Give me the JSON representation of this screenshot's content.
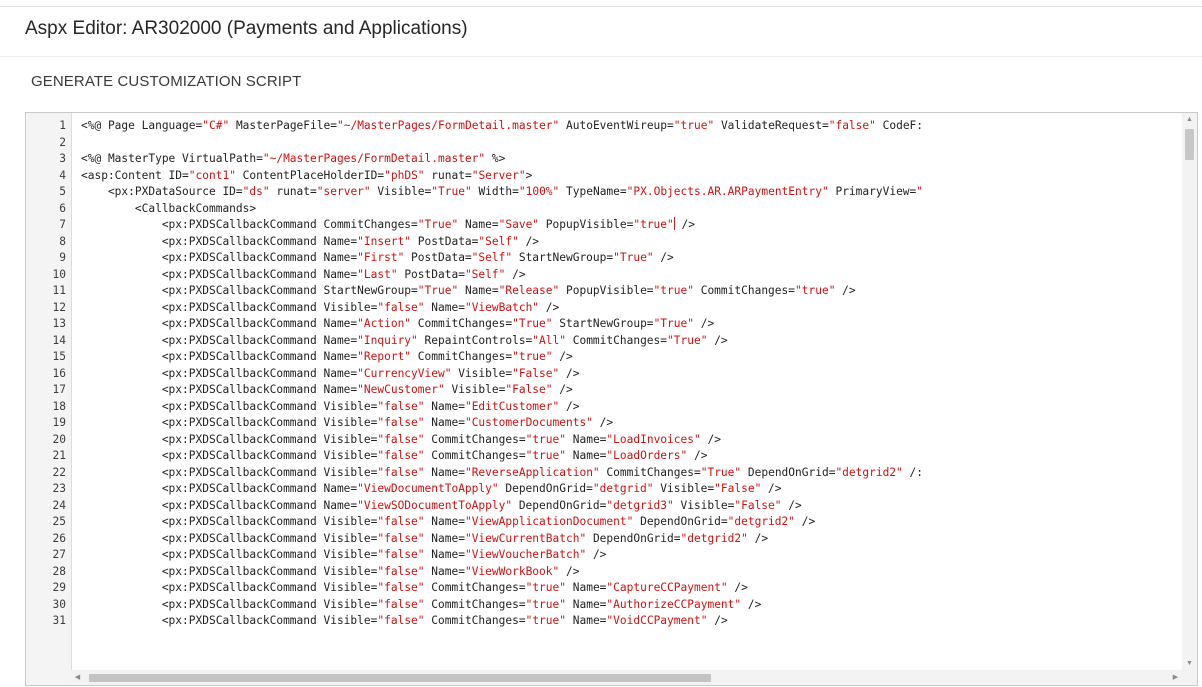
{
  "header": {
    "title": "Aspx Editor: AR302000 (Payments and Applications)",
    "generate_button": "GENERATE CUSTOMIZATION SCRIPT"
  },
  "editor": {
    "line_numbers": [
      "1",
      "2",
      "3",
      "4",
      "5",
      "6",
      "7",
      "8",
      "9",
      "10",
      "11",
      "12",
      "13",
      "14",
      "15",
      "16",
      "17",
      "18",
      "19",
      "20",
      "21",
      "22",
      "23",
      "24",
      "25",
      "26",
      "27",
      "28",
      "29",
      "30",
      "31"
    ],
    "lines": [
      [
        [
          "t",
          "<%@ Page Language="
        ],
        [
          "s",
          "\"C#\""
        ],
        [
          "t",
          " MasterPageFile="
        ],
        [
          "s",
          "\"~/MasterPages/FormDetail.master\""
        ],
        [
          "t",
          " AutoEventWireup="
        ],
        [
          "s",
          "\"true\""
        ],
        [
          "t",
          " ValidateRequest="
        ],
        [
          "s",
          "\"false\""
        ],
        [
          "t",
          " CodeF:"
        ]
      ],
      [],
      [
        [
          "t",
          "<%@ MasterType VirtualPath="
        ],
        [
          "s",
          "\"~/MasterPages/FormDetail.master\""
        ],
        [
          "t",
          " %>"
        ]
      ],
      [
        [
          "t",
          "<asp:Content ID="
        ],
        [
          "s",
          "\"cont1\""
        ],
        [
          "t",
          " ContentPlaceHolderID="
        ],
        [
          "s",
          "\"phDS\""
        ],
        [
          "t",
          " runat="
        ],
        [
          "s",
          "\"Server\""
        ],
        [
          "t",
          ">"
        ]
      ],
      [
        [
          "t",
          "    <px:PXDataSource ID="
        ],
        [
          "s",
          "\"ds\""
        ],
        [
          "t",
          " runat="
        ],
        [
          "s",
          "\"server\""
        ],
        [
          "t",
          " Visible="
        ],
        [
          "s",
          "\"True\""
        ],
        [
          "t",
          " Width="
        ],
        [
          "s",
          "\"100%\""
        ],
        [
          "t",
          " TypeName="
        ],
        [
          "s",
          "\"PX.Objects.AR.ARPaymentEntry\""
        ],
        [
          "t",
          " PrimaryView="
        ],
        [
          "s",
          "\""
        ]
      ],
      [
        [
          "t",
          "        <CallbackCommands>"
        ]
      ],
      [
        [
          "t",
          "            <px:PXDSCallbackCommand CommitChanges="
        ],
        [
          "s",
          "\"True\""
        ],
        [
          "t",
          " Name="
        ],
        [
          "s",
          "\"Save\""
        ],
        [
          "t",
          " PopupVisible="
        ],
        [
          "s",
          "\"true\""
        ],
        [
          "c",
          ""
        ],
        [
          "t",
          " />"
        ]
      ],
      [
        [
          "t",
          "            <px:PXDSCallbackCommand Name="
        ],
        [
          "s",
          "\"Insert\""
        ],
        [
          "t",
          " PostData="
        ],
        [
          "s",
          "\"Self\""
        ],
        [
          "t",
          " />"
        ]
      ],
      [
        [
          "t",
          "            <px:PXDSCallbackCommand Name="
        ],
        [
          "s",
          "\"First\""
        ],
        [
          "t",
          " PostData="
        ],
        [
          "s",
          "\"Self\""
        ],
        [
          "t",
          " StartNewGroup="
        ],
        [
          "s",
          "\"True\""
        ],
        [
          "t",
          " />"
        ]
      ],
      [
        [
          "t",
          "            <px:PXDSCallbackCommand Name="
        ],
        [
          "s",
          "\"Last\""
        ],
        [
          "t",
          " PostData="
        ],
        [
          "s",
          "\"Self\""
        ],
        [
          "t",
          " />"
        ]
      ],
      [
        [
          "t",
          "            <px:PXDSCallbackCommand StartNewGroup="
        ],
        [
          "s",
          "\"True\""
        ],
        [
          "t",
          " Name="
        ],
        [
          "s",
          "\"Release\""
        ],
        [
          "t",
          " PopupVisible="
        ],
        [
          "s",
          "\"true\""
        ],
        [
          "t",
          " CommitChanges="
        ],
        [
          "s",
          "\"true\""
        ],
        [
          "t",
          " />"
        ]
      ],
      [
        [
          "t",
          "            <px:PXDSCallbackCommand Visible="
        ],
        [
          "s",
          "\"false\""
        ],
        [
          "t",
          " Name="
        ],
        [
          "s",
          "\"ViewBatch\""
        ],
        [
          "t",
          " />"
        ]
      ],
      [
        [
          "t",
          "            <px:PXDSCallbackCommand Name="
        ],
        [
          "s",
          "\"Action\""
        ],
        [
          "t",
          " CommitChanges="
        ],
        [
          "s",
          "\"True\""
        ],
        [
          "t",
          " StartNewGroup="
        ],
        [
          "s",
          "\"True\""
        ],
        [
          "t",
          " />"
        ]
      ],
      [
        [
          "t",
          "            <px:PXDSCallbackCommand Name="
        ],
        [
          "s",
          "\"Inquiry\""
        ],
        [
          "t",
          " RepaintControls="
        ],
        [
          "s",
          "\"All\""
        ],
        [
          "t",
          " CommitChanges="
        ],
        [
          "s",
          "\"True\""
        ],
        [
          "t",
          " />"
        ]
      ],
      [
        [
          "t",
          "            <px:PXDSCallbackCommand Name="
        ],
        [
          "s",
          "\"Report\""
        ],
        [
          "t",
          " CommitChanges="
        ],
        [
          "s",
          "\"true\""
        ],
        [
          "t",
          " />"
        ]
      ],
      [
        [
          "t",
          "            <px:PXDSCallbackCommand Name="
        ],
        [
          "s",
          "\"CurrencyView\""
        ],
        [
          "t",
          " Visible="
        ],
        [
          "s",
          "\"False\""
        ],
        [
          "t",
          " />"
        ]
      ],
      [
        [
          "t",
          "            <px:PXDSCallbackCommand Name="
        ],
        [
          "s",
          "\"NewCustomer\""
        ],
        [
          "t",
          " Visible="
        ],
        [
          "s",
          "\"False\""
        ],
        [
          "t",
          " />"
        ]
      ],
      [
        [
          "t",
          "            <px:PXDSCallbackCommand Visible="
        ],
        [
          "s",
          "\"false\""
        ],
        [
          "t",
          " Name="
        ],
        [
          "s",
          "\"EditCustomer\""
        ],
        [
          "t",
          " />"
        ]
      ],
      [
        [
          "t",
          "            <px:PXDSCallbackCommand Visible="
        ],
        [
          "s",
          "\"false\""
        ],
        [
          "t",
          " Name="
        ],
        [
          "s",
          "\"CustomerDocuments\""
        ],
        [
          "t",
          " />"
        ]
      ],
      [
        [
          "t",
          "            <px:PXDSCallbackCommand Visible="
        ],
        [
          "s",
          "\"false\""
        ],
        [
          "t",
          " CommitChanges="
        ],
        [
          "s",
          "\"true\""
        ],
        [
          "t",
          " Name="
        ],
        [
          "s",
          "\"LoadInvoices\""
        ],
        [
          "t",
          " />"
        ]
      ],
      [
        [
          "t",
          "            <px:PXDSCallbackCommand Visible="
        ],
        [
          "s",
          "\"false\""
        ],
        [
          "t",
          " CommitChanges="
        ],
        [
          "s",
          "\"true\""
        ],
        [
          "t",
          " Name="
        ],
        [
          "s",
          "\"LoadOrders\""
        ],
        [
          "t",
          " />"
        ]
      ],
      [
        [
          "t",
          "            <px:PXDSCallbackCommand Visible="
        ],
        [
          "s",
          "\"false\""
        ],
        [
          "t",
          " Name="
        ],
        [
          "s",
          "\"ReverseApplication\""
        ],
        [
          "t",
          " CommitChanges="
        ],
        [
          "s",
          "\"True\""
        ],
        [
          "t",
          " DependOnGrid="
        ],
        [
          "s",
          "\"detgrid2\""
        ],
        [
          "t",
          " /:"
        ]
      ],
      [
        [
          "t",
          "            <px:PXDSCallbackCommand Name="
        ],
        [
          "s",
          "\"ViewDocumentToApply\""
        ],
        [
          "t",
          " DependOnGrid="
        ],
        [
          "s",
          "\"detgrid\""
        ],
        [
          "t",
          " Visible="
        ],
        [
          "s",
          "\"False\""
        ],
        [
          "t",
          " />"
        ]
      ],
      [
        [
          "t",
          "            <px:PXDSCallbackCommand Name="
        ],
        [
          "s",
          "\"ViewSODocumentToApply\""
        ],
        [
          "t",
          " DependOnGrid="
        ],
        [
          "s",
          "\"detgrid3\""
        ],
        [
          "t",
          " Visible="
        ],
        [
          "s",
          "\"False\""
        ],
        [
          "t",
          " />"
        ]
      ],
      [
        [
          "t",
          "            <px:PXDSCallbackCommand Visible="
        ],
        [
          "s",
          "\"false\""
        ],
        [
          "t",
          " Name="
        ],
        [
          "s",
          "\"ViewApplicationDocument\""
        ],
        [
          "t",
          " DependOnGrid="
        ],
        [
          "s",
          "\"detgrid2\""
        ],
        [
          "t",
          " />"
        ]
      ],
      [
        [
          "t",
          "            <px:PXDSCallbackCommand Visible="
        ],
        [
          "s",
          "\"false\""
        ],
        [
          "t",
          " Name="
        ],
        [
          "s",
          "\"ViewCurrentBatch\""
        ],
        [
          "t",
          " DependOnGrid="
        ],
        [
          "s",
          "\"detgrid2\""
        ],
        [
          "t",
          " />"
        ]
      ],
      [
        [
          "t",
          "            <px:PXDSCallbackCommand Visible="
        ],
        [
          "s",
          "\"false\""
        ],
        [
          "t",
          " Name="
        ],
        [
          "s",
          "\"ViewVoucherBatch\""
        ],
        [
          "t",
          " />"
        ]
      ],
      [
        [
          "t",
          "            <px:PXDSCallbackCommand Visible="
        ],
        [
          "s",
          "\"false\""
        ],
        [
          "t",
          " Name="
        ],
        [
          "s",
          "\"ViewWorkBook\""
        ],
        [
          "t",
          " />"
        ]
      ],
      [
        [
          "t",
          "            <px:PXDSCallbackCommand Visible="
        ],
        [
          "s",
          "\"false\""
        ],
        [
          "t",
          " CommitChanges="
        ],
        [
          "s",
          "\"true\""
        ],
        [
          "t",
          " Name="
        ],
        [
          "s",
          "\"CaptureCCPayment\""
        ],
        [
          "t",
          " />"
        ]
      ],
      [
        [
          "t",
          "            <px:PXDSCallbackCommand Visible="
        ],
        [
          "s",
          "\"false\""
        ],
        [
          "t",
          " CommitChanges="
        ],
        [
          "s",
          "\"true\""
        ],
        [
          "t",
          " Name="
        ],
        [
          "s",
          "\"AuthorizeCCPayment\""
        ],
        [
          "t",
          " />"
        ]
      ],
      [
        [
          "t",
          "            <px:PXDSCallbackCommand Visible="
        ],
        [
          "s",
          "\"false\""
        ],
        [
          "t",
          " CommitChanges="
        ],
        [
          "s",
          "\"true\""
        ],
        [
          "t",
          " Name="
        ],
        [
          "s",
          "\"VoidCCPayment\""
        ],
        [
          "t",
          " />"
        ]
      ]
    ]
  },
  "scrollbars": {
    "up_icon": "▲",
    "down_icon": "▼",
    "left_icon": "◀",
    "right_icon": "▶"
  },
  "colors": {
    "string": "#d01010",
    "text": "#222222",
    "caret": "#e01818"
  }
}
